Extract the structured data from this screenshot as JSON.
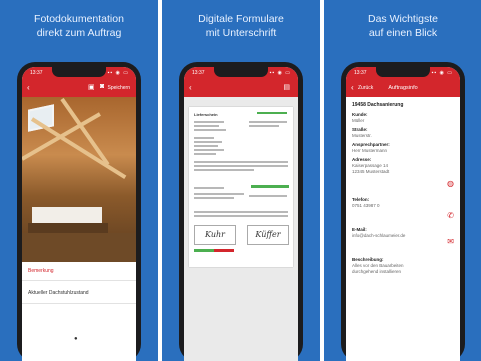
{
  "panels": [
    {
      "heading": [
        "Fotodokumentation",
        "direkt zum Auftrag"
      ]
    },
    {
      "heading": [
        "Digitale Formulare",
        "mit Unterschrift"
      ]
    },
    {
      "heading": [
        "Das Wichtigste",
        "auf einen Blick"
      ]
    }
  ],
  "status_bar": {
    "time": "13:37",
    "icons": "▪▪ ◉ ▭"
  },
  "screen1": {
    "save_label": "Speichern",
    "field_label": "Bemerkung",
    "field_value": "Aktueller Dachstuhlzustand"
  },
  "screen2": {
    "doc_title": "Lieferschein",
    "signature_left": "Kuhr",
    "signature_right": "Küffer"
  },
  "screen3": {
    "back_label": "Zurück",
    "title": "Auftragsinfo",
    "heading": "19458 Dachsanierung",
    "rows": [
      {
        "label": "Kunde:",
        "value": "Müller"
      },
      {
        "label": "Straße:",
        "value": "Musterstr."
      },
      {
        "label": "Ansprechpartner:",
        "value": "Herr Mustermann"
      },
      {
        "label": "Adresse:",
        "value": "Kaiserpassage 14"
      },
      {
        "label": "",
        "value": "12345 Musterstadt"
      },
      {
        "label": "Telefon:",
        "value": "0751 43987 0"
      },
      {
        "label": "E-Mail:",
        "value": "info@dach-schlaumeier.de"
      },
      {
        "label": "Beschreibung:",
        "value": "Alles vor den Bauarbeiten"
      },
      {
        "label": "",
        "value": "durchgehend installieren"
      }
    ]
  },
  "colors": {
    "background": "#2a6fbe",
    "app_red": "#d3262c",
    "accent_green": "#4caf50"
  },
  "icons": [
    "back-chevron",
    "camera-icon",
    "document-icon",
    "globe-icon",
    "phone-icon",
    "mail-icon"
  ]
}
